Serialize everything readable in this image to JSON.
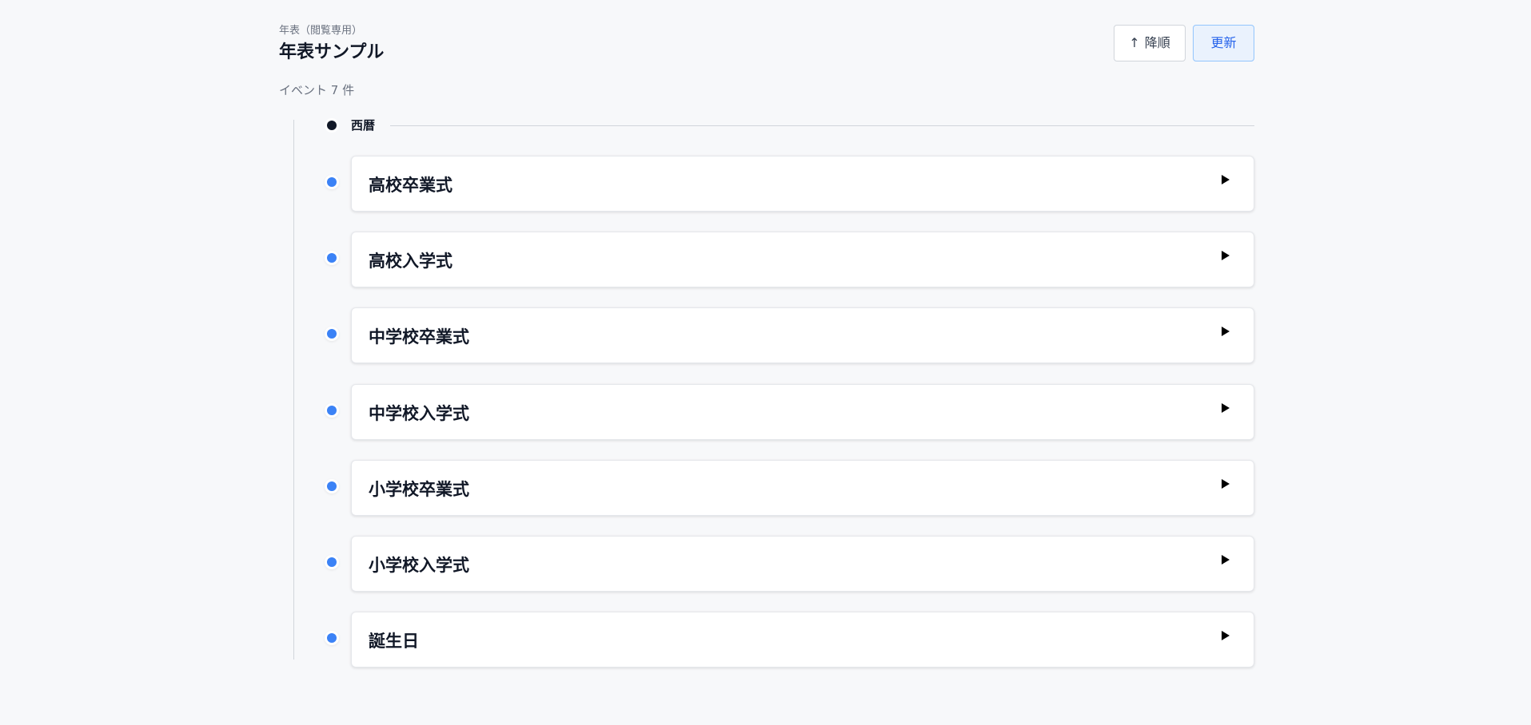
{
  "header": {
    "subtitle": "年表（閲覧専用）",
    "title": "年表サンプル",
    "event_count": "イベント 7 件",
    "sort_button": {
      "arrow": "↑",
      "label": "降順"
    },
    "refresh_button_label": "更新"
  },
  "timeline": {
    "era_label": "西暦",
    "events": [
      {
        "title": "高校卒業式",
        "expanded": false
      },
      {
        "title": "高校入学式",
        "expanded": false
      },
      {
        "title": "中学校卒業式",
        "expanded": false
      },
      {
        "title": "中学校入学式",
        "expanded": false
      },
      {
        "title": "小学校卒業式",
        "expanded": false
      },
      {
        "title": "小学校入学式",
        "expanded": false
      },
      {
        "title": "誕生日",
        "expanded": false
      }
    ]
  },
  "icons": {
    "sort": "arrow-up-icon",
    "event_toggle": "triangle-right-icon"
  },
  "colors": {
    "background": "#f7f8fa",
    "event_dot": "#3b82f6",
    "era_dot": "#111827",
    "refresh_button_bg": "#eaf2fd",
    "refresh_button_border": "#93c5fd",
    "refresh_button_text": "#2563eb"
  }
}
